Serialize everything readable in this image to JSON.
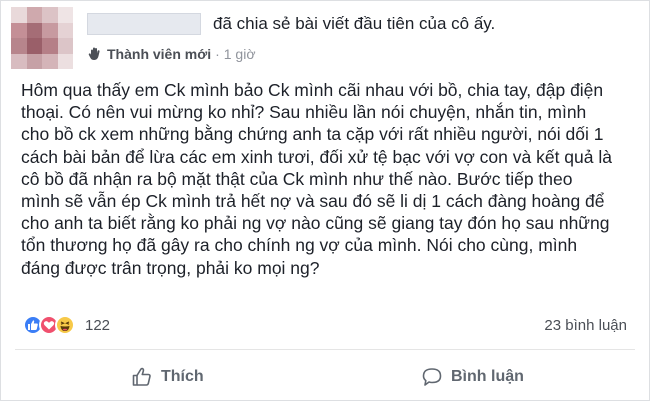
{
  "post": {
    "shared_text": "đã chia sẻ bài viết đầu tiên của cô ấy.",
    "author_role": "Thành viên mới",
    "separator": "·",
    "time": "1 giờ",
    "body_lines": [
      "Hôm qua thấy em Ck mình bảo Ck mình cãi nhau với bồ, chia tay, đập điện",
      "thoại. Có nên vui mừng ko nhỉ? Sau nhiều lần nói chuyện, nhắn tin, mình",
      "cho bồ ck xem những bằng chứng anh ta cặp với rất nhiều người, nói dối 1",
      "cách bài bản để lừa các em xinh tươi, đối xử tệ bạc với vợ con và kết quả là",
      "cô bồ đã nhận ra bộ mặt thật của Ck mình như thế nào. Bước tiếp theo",
      "mình sẽ vẫn ép Ck mình trả hết nợ và sau đó sẽ li dị 1 cách đàng hoàng để",
      "cho anh ta biết rằng ko phải ng vợ nào cũng sẽ giang tay đón họ sau những",
      "tổn thương họ đã gây ra cho chính ng vợ của mình. Nói cho cùng, mình",
      "đáng được trân trọng, phải ko mọi ng?"
    ]
  },
  "footer": {
    "reaction_count": "122",
    "comment_count": "23 bình luận",
    "like_label": "Thích",
    "comment_label": "Bình luận"
  },
  "icons": {
    "member": "member-hand-icon",
    "reactions": [
      "like-reaction-icon",
      "love-reaction-icon",
      "haha-reaction-icon"
    ],
    "like": "thumbs-up-icon",
    "comment": "comment-bubble-icon"
  },
  "colors": {
    "text": "#1d2129",
    "muted": "#90949c",
    "like_reaction": "#3b7ef6",
    "love_reaction": "#f0506e",
    "haha_reaction": "#f7c948"
  }
}
